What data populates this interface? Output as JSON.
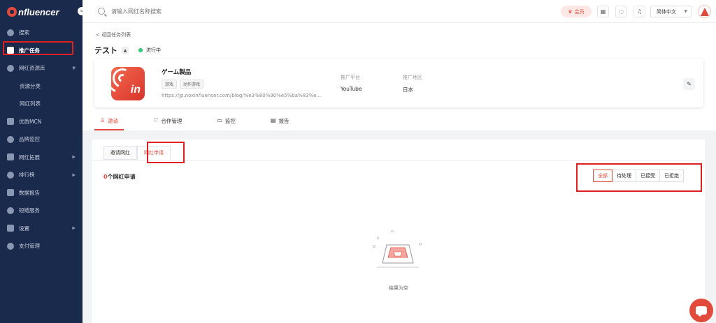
{
  "brand": {
    "name": "nfluencer"
  },
  "sidebar": {
    "collapse": "«",
    "items": [
      {
        "label": "搜索",
        "icon": "compass-icon"
      },
      {
        "label": "推广任务",
        "icon": "task-icon"
      },
      {
        "label": "网红资源库",
        "icon": "heart-icon",
        "arrow": "▼"
      },
      {
        "label": "资源分类",
        "sub": true
      },
      {
        "label": "网红列表",
        "sub": true
      },
      {
        "label": "优质MCN",
        "icon": "building-icon"
      },
      {
        "label": "品牌监控",
        "icon": "monitor-icon"
      },
      {
        "label": "网红拓展",
        "icon": "mail-icon",
        "arrow": "▶"
      },
      {
        "label": "排行榜",
        "icon": "bars-icon",
        "arrow": "▶"
      },
      {
        "label": "数据报告",
        "icon": "report-icon"
      },
      {
        "label": "短链服务",
        "icon": "link-icon"
      },
      {
        "label": "设置",
        "icon": "gear-icon",
        "arrow": "▶"
      },
      {
        "label": "支付管理",
        "icon": "wallet-icon"
      }
    ]
  },
  "topbar": {
    "search_placeholder": "请输入网红名称搜索",
    "vip_label": "会员",
    "language": "简体中文"
  },
  "header": {
    "back_label": "返回任务列表",
    "task_title": "テスト",
    "status_label": "进行中"
  },
  "task_card": {
    "game_name": "ゲーム製品",
    "tags": [
      "游戏",
      "动作游戏"
    ],
    "url": "https://jp.noxinfluencer.com/blog/%e3%80%90%e5%ba%83%e...",
    "platform_label": "推广平台",
    "platform_value": "YouTube",
    "region_label": "推广地区",
    "region_value": "日本"
  },
  "tabs": [
    {
      "label": "邀请",
      "icon": "person-icon"
    },
    {
      "label": "合作管理",
      "icon": "handshake-icon"
    },
    {
      "label": "监控",
      "icon": "screen-icon"
    },
    {
      "label": "报告",
      "icon": "document-icon"
    }
  ],
  "panel": {
    "subtabs": [
      "邀请网红",
      "网红申请"
    ],
    "count_number": "0",
    "count_suffix": "个网红申请",
    "filters": [
      "全部",
      "待处理",
      "已接受",
      "已拒绝"
    ],
    "empty_text": "结果为空"
  },
  "colors": {
    "accent": "#e24b3b",
    "sidebar": "#1a2a4d",
    "highlight": "#e02020",
    "status": "#2ecc71"
  }
}
